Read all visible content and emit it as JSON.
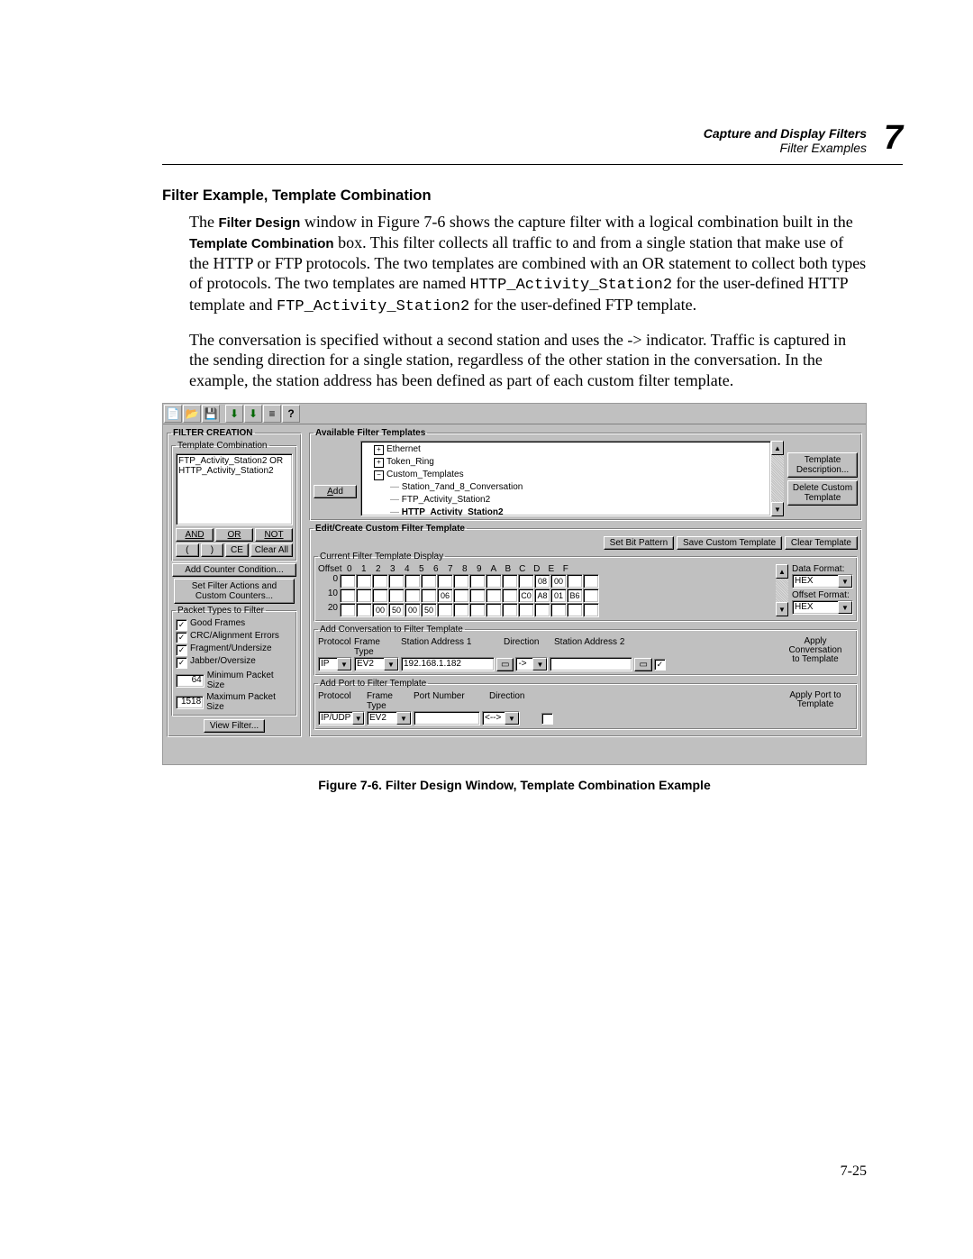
{
  "header": {
    "line1": "Capture and Display Filters",
    "line2": "Filter Examples",
    "chapter_number": "7"
  },
  "section_title": "Filter Example, Template Combination",
  "para1_parts": {
    "a": "The ",
    "b": "Filter Design",
    "c": " window in Figure 7-6 shows the capture filter with a logical combination built in the ",
    "d": "Template Combination",
    "e": " box. This filter collects all traffic to and from a single station that make use of the HTTP or FTP protocols. The two templates are combined with an OR statement to collect both types of protocols. The two templates are named ",
    "f": "HTTP_Activity_Station2",
    "g": " for the user-defined HTTP template and ",
    "h": "FTP_Activity_Station2",
    "i": " for the user-defined FTP template."
  },
  "para2": "The conversation is specified without a second station and uses the -> indicator. Traffic is captured in the sending direction for a single station, regardless of the other station in the conversation. In the example, the station address has been defined as part of each custom filter template.",
  "figure_caption": "Figure 7-6.  Filter Design Window, Template Combination Example",
  "page_number": "7-25",
  "ui": {
    "toolbar_icons": [
      "📄",
      "📂",
      "💾",
      "",
      "⬇",
      "⬇",
      "≡",
      "?"
    ],
    "filter_creation": {
      "legend": "FILTER CREATION",
      "tc_legend": "Template Combination",
      "tc_lines": [
        "FTP_Activity_Station2 OR",
        "HTTP_Activity_Station2"
      ],
      "btn_and": "AND",
      "btn_or": "OR",
      "btn_not": "NOT",
      "btn_lp": "(",
      "btn_rp": ")",
      "btn_ce": "CE",
      "btn_clearall": "Clear All",
      "btn_add_counter": "Add Counter Condition...",
      "btn_set_actions": "Set Filter Actions and\nCustom Counters...",
      "pkttypes_legend": "Packet Types to Filter",
      "chk_good": "Good Frames",
      "chk_crc": "CRC/Alignment Errors",
      "chk_frag": "Fragment/Undersize",
      "chk_jabber": "Jabber/Oversize",
      "min_pkt_val": "64",
      "min_pkt_lbl": "Minimum Packet Size",
      "max_pkt_val": "1518",
      "max_pkt_lbl": "Maximum Packet Size",
      "btn_view_filter": "View Filter..."
    },
    "available_templates": {
      "legend": "Available Filter Templates",
      "btn_add": "Add",
      "tree": [
        {
          "sym": "+",
          "label": "Ethernet",
          "indent": 0
        },
        {
          "sym": "+",
          "label": "Token_Ring",
          "indent": 0
        },
        {
          "sym": "−",
          "label": "Custom_Templates",
          "indent": 0
        },
        {
          "sym": "",
          "label": "Station_7and_8_Conversation",
          "indent": 1
        },
        {
          "sym": "",
          "label": "FTP_Activity_Station2",
          "indent": 1
        },
        {
          "sym": "",
          "label": "HTTP_Activity_Station2",
          "indent": 1,
          "bold": true
        }
      ],
      "btn_template_desc": "Template\nDescription...",
      "btn_delete_custom": "Delete Custom\nTemplate"
    },
    "edit_template": {
      "legend": "Edit/Create Custom Filter Template",
      "btn_set_bit": "Set Bit Pattern",
      "btn_save_custom": "Save Custom Template",
      "btn_clear_template": "Clear Template",
      "cft_legend": "Current Filter Template Display",
      "offset_lbl": "Offset",
      "cols": [
        "0",
        "1",
        "2",
        "3",
        "4",
        "5",
        "6",
        "7",
        "8",
        "9",
        "A",
        "B",
        "C",
        "D",
        "E",
        "F"
      ],
      "rows": [
        {
          "label": "0",
          "cells": [
            "",
            "",
            "",
            "",
            "",
            "",
            "",
            "",
            "",
            "",
            "",
            "",
            "08",
            "00",
            "",
            ""
          ]
        },
        {
          "label": "10",
          "cells": [
            "",
            "",
            "",
            "",
            "",
            "",
            "06",
            "",
            "",
            "",
            "",
            "C0",
            "A8",
            "01",
            "B6",
            ""
          ]
        },
        {
          "label": "20",
          "cells": [
            "",
            "",
            "00",
            "50",
            "00",
            "50",
            "",
            "",
            "",
            "",
            "",
            "",
            "",
            "",
            "",
            ""
          ]
        }
      ],
      "data_format_lbl": "Data Format:",
      "data_format_val": "HEX",
      "offset_format_lbl": "Offset Format:",
      "offset_format_val": "HEX",
      "add_conv_legend": "Add Conversation to Filter Template",
      "conv_hdr": {
        "proto": "Protocol",
        "ftype": "Frame Type",
        "sa1": "Station Address 1",
        "dir": "Direction",
        "sa2": "Station Address 2"
      },
      "conv_proto": "IP",
      "conv_ftype": "EV2",
      "conv_sa1": "192.168.1.182",
      "conv_sa2": "",
      "conv_dir": "->",
      "btn_apply_conv": "Apply Conversation\nto Template",
      "chk_to_template": true,
      "add_port_legend": "Add Port to Filter Template",
      "port_hdr": {
        "proto": "Protocol",
        "ftype": "Frame Type",
        "pn": "Port Number",
        "dir": "Direction"
      },
      "port_proto": "IP/UDP",
      "port_ftype": "EV2",
      "port_num": "",
      "port_dir": "<-->",
      "btn_apply_port": "Apply Port to\nTemplate",
      "chk_port_to_template": false
    }
  }
}
